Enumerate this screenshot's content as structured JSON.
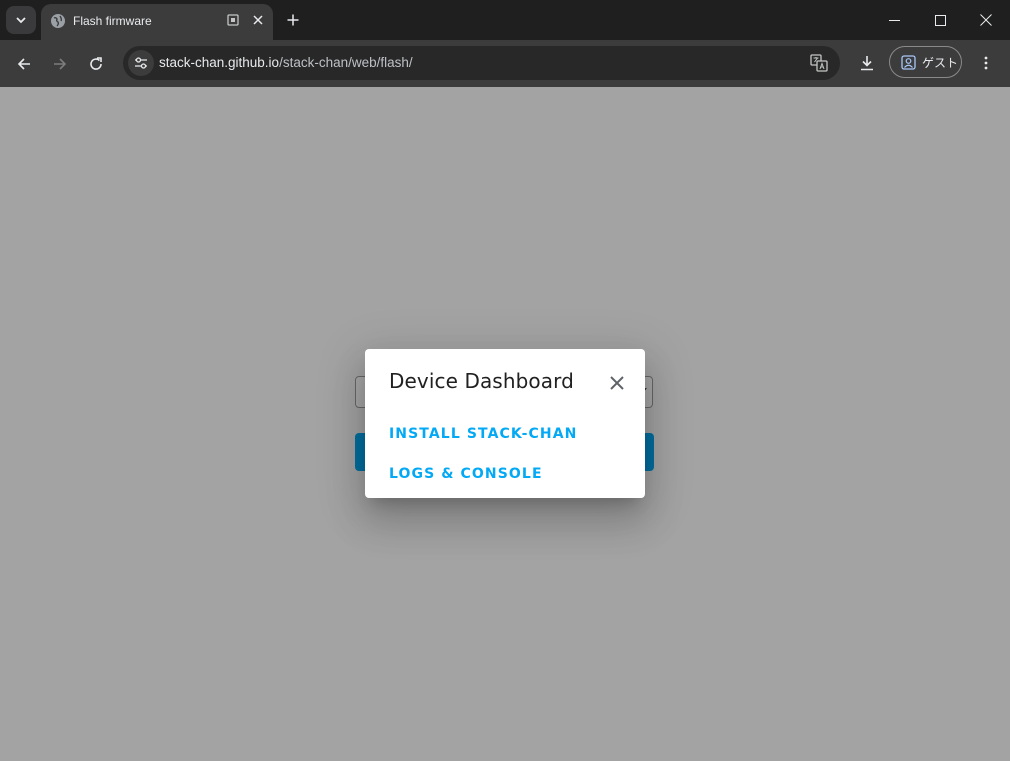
{
  "browser": {
    "tab": {
      "title": "Flash firmware"
    },
    "url": {
      "host": "stack-chan.github.io",
      "path": "/stack-chan/web/flash/"
    },
    "profile": {
      "label": "ゲスト"
    }
  },
  "dialog": {
    "title": "Device Dashboard",
    "actions": [
      {
        "label": "INSTALL STACK-CHAN"
      },
      {
        "label": "LOGS & CONSOLE"
      }
    ]
  },
  "colors": {
    "accent": "#03a9f4",
    "dialog_background": "#ffffff",
    "browser_frame": "#1f1f1f",
    "toolbar": "#3c3c3c"
  },
  "icons": {
    "tab_search": "chevron-down-icon",
    "favicon": "globe-icon",
    "tab_memory": "memory-saver-icon",
    "tab_close": "close-icon",
    "new_tab": "plus-icon",
    "minimize": "minimize-icon",
    "maximize": "maximize-icon",
    "window_close": "close-icon",
    "back": "arrow-left-icon",
    "forward": "arrow-right-icon",
    "reload": "reload-icon",
    "site_info": "tune-icon",
    "translate": "translate-icon",
    "download": "download-icon",
    "profile": "person-icon",
    "menu": "more-vert-icon",
    "dialog_close": "close-icon"
  }
}
